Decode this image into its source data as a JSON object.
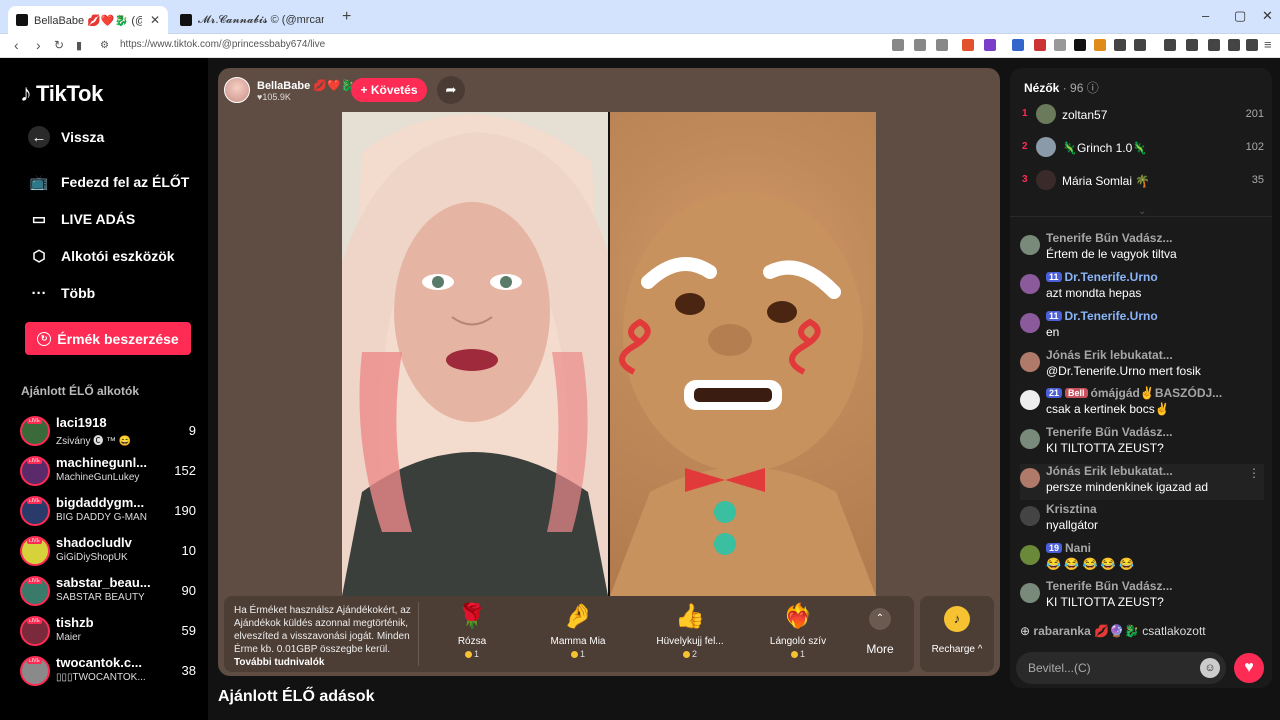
{
  "browser": {
    "tabs": [
      {
        "title": "BellaBabe 💋❤️🐉 (@princess"
      },
      {
        "title": "𝓜𝓻.𝓒𝓪𝓷𝓷𝓪𝓫𝓲𝓼 © (@mrcannabis_)"
      }
    ],
    "new_tab": "+",
    "url": "https://www.tiktok.com/@princessbaby674/live",
    "window_controls": [
      "–",
      "▢",
      "✕"
    ]
  },
  "sidebar": {
    "logo_text": "TikTok",
    "nav": [
      {
        "label": "Vissza",
        "icon": "back-arrow-icon"
      },
      {
        "label": "Fedezd fel az ÉLŐT",
        "icon": "tv-icon"
      },
      {
        "label": "LIVE ADÁS",
        "icon": "camera-icon"
      },
      {
        "label": "Alkotói eszközök",
        "icon": "creator-tools-icon"
      },
      {
        "label": "Több",
        "icon": "more-icon"
      }
    ],
    "coins_button": "Érmék beszerzése",
    "recommended_title": "Ajánlott ÉLŐ alkotók",
    "creators": [
      {
        "name": "laci1918",
        "sub": "Zsivány 🅒 ™ 😄",
        "count": "9"
      },
      {
        "name": "machinegunl...",
        "sub": "MachineGunLukey",
        "count": "152"
      },
      {
        "name": "bigdaddygm...",
        "sub": "BIG DADDY G-MAN",
        "count": "190"
      },
      {
        "name": "shadocludlv",
        "sub": "GiGiDiyShopUK",
        "count": "10"
      },
      {
        "name": "sabstar_beau...",
        "sub": "SABSTAR BEAUTY",
        "count": "90"
      },
      {
        "name": "tishzb",
        "sub": "Maier",
        "count": "59"
      },
      {
        "name": "twocantok.c...",
        "sub": "▯▯▯TWOCANTOK...",
        "count": "38"
      }
    ],
    "live_badge": "LIVE"
  },
  "stream": {
    "host_name": "BellaBabe 💋❤️🐉",
    "host_likes": "♥105.9K",
    "follow_label": "+ Követés",
    "gift_info": "Ha Érméket használsz Ajándékokért, az Ajándékok küldés azonnal megtörténik, elveszíted a visszavonási jogát. Minden Érme kb. 0.01GBP összegbe kerül.",
    "gift_info_link": "További tudnivalók",
    "gifts": [
      {
        "name": "Rózsa",
        "price": "1",
        "icon": "🌹"
      },
      {
        "name": "Mamma Mia",
        "price": "1",
        "icon": "🤌"
      },
      {
        "name": "Hüvelykujj fel...",
        "price": "2",
        "icon": "👍"
      },
      {
        "name": "Lángoló szív",
        "price": "1",
        "icon": "❤️‍🔥"
      }
    ],
    "more_label": "More",
    "recharge_label": "Recharge ^"
  },
  "recommended_live_title": "Ajánlott ÉLŐ adások",
  "chat": {
    "viewers_title": "Nézők",
    "viewers_count": "· 96",
    "viewers": [
      {
        "rank": "1",
        "name": "zoltan57",
        "score": "201"
      },
      {
        "rank": "2",
        "name": "🦎Grinch 1.0🦎",
        "score": "102"
      },
      {
        "rank": "3",
        "name": "Mária Somlai 🌴",
        "score": "35"
      }
    ],
    "messages": [
      {
        "name": "Tenerife Bűn Vadász...",
        "text": "Értem de le vagyok tiltva",
        "badge": ""
      },
      {
        "name": "Dr.Tenerife.Urno",
        "text": "azt mondta hepas",
        "badge": "11"
      },
      {
        "name": "Dr.Tenerife.Urno",
        "text": "en",
        "badge": "11"
      },
      {
        "name": "Jónás Erik lebukatat...",
        "text": "@Dr.Tenerife.Urno mert fosik",
        "badge": ""
      },
      {
        "name": "ómájgád✌BASZÓDJ...",
        "text": "csak a kertinek bocs✌",
        "badge": "21"
      },
      {
        "name": "Tenerife Bűn Vadász...",
        "text": "KI TILTOTTA ZEUST?",
        "badge": ""
      },
      {
        "name": "Jónás Erik lebukatat...",
        "text": "persze mindenkinek igazad ad",
        "badge": ""
      },
      {
        "name": "Krisztina",
        "text": "nyallgátor",
        "badge": ""
      },
      {
        "name": "Nani",
        "text": "😂 😂 😂 😂 😂",
        "badge": "19"
      },
      {
        "name": "Tenerife Bűn Vadász...",
        "text": "KI TILTOTTA ZEUST?",
        "badge": ""
      }
    ],
    "extra_badge": "Bell",
    "joined_name": "rabaranka 💋🔮🐉",
    "joined_text": "csatlakozott",
    "input_placeholder": "Bevitel...(C)"
  },
  "colors": {
    "accent": "#fe2c55",
    "stream_bg": "#5f4c43",
    "chat_bg": "#1a1a1a"
  }
}
